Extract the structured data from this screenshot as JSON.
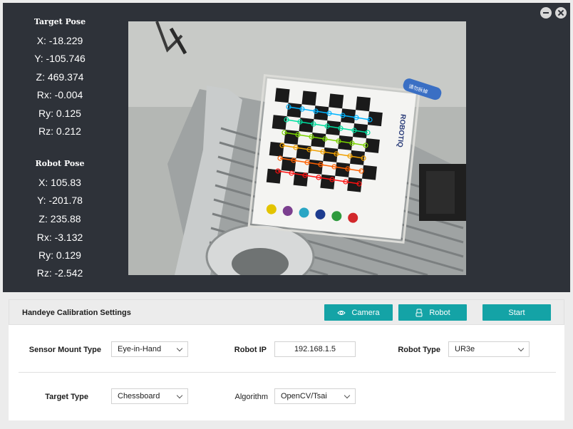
{
  "target_pose": {
    "title": "Target Pose",
    "x": "X:  -18.229",
    "y": "Y: -105.746",
    "z": "Z: 469.374",
    "rx": "Rx: -0.004",
    "ry": "Ry: 0.125",
    "rz": "Rz: 0.212"
  },
  "robot_pose": {
    "title": "Robot Pose",
    "x": "X: 105.83",
    "y": "Y: -201.78",
    "z": "Z: 235.88",
    "rx": "Rx: -3.132",
    "ry": "Ry: 0.129",
    "rz": "Rz: -2.542"
  },
  "camera_feed": {
    "board_brand": "ROBOTIQ",
    "sticker_text": "请勿拆掉"
  },
  "settings": {
    "title": "Handeye Calibration Settings",
    "buttons": {
      "camera": "Camera",
      "robot": "Robot",
      "start": "Start"
    },
    "sensor_mount_type": {
      "label": "Sensor Mount Type",
      "value": "Eye-in-Hand"
    },
    "robot_ip": {
      "label": "Robot IP",
      "value": "192.168.1.5"
    },
    "robot_type": {
      "label": "Robot Type",
      "value": "UR3e"
    },
    "target_type": {
      "label": "Target Type",
      "value": "Chessboard"
    },
    "algorithm": {
      "label": "Algorithm",
      "value": "OpenCV/Tsai"
    }
  },
  "colors": {
    "background_dark": "#2e3239",
    "accent": "#14a3a6",
    "panel": "#ffffff"
  },
  "icons": [
    "minimize-icon",
    "close-icon",
    "eye-icon",
    "robot-icon",
    "chevron-down-icon"
  ]
}
